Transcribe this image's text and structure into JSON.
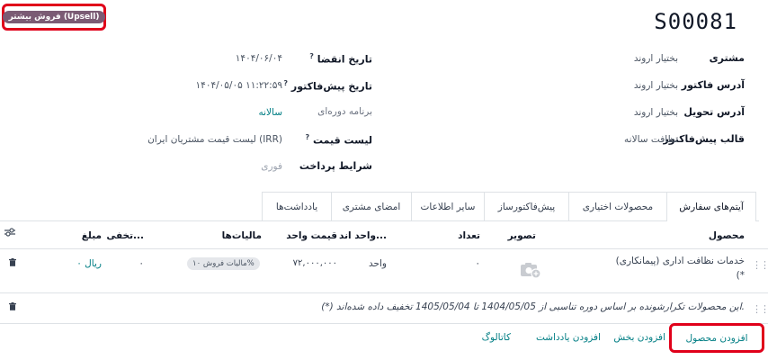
{
  "header": {
    "order_number": "S00081",
    "upsell_badge": "فروش بیشتر (Upsell)"
  },
  "left_fields": [
    {
      "label": "مشتری",
      "value": "بختیار اروند"
    },
    {
      "label": "آدرس فاکتور",
      "value": "بختیار اروند"
    },
    {
      "label": "آدرس تحویل",
      "value": "بختیار اروند"
    },
    {
      "label": "قالب پیش‌فاکتور",
      "value": "نظافت سالانه"
    }
  ],
  "right_fields": [
    {
      "label": "تاریخ انقضا",
      "help": "?",
      "value": "۱۴۰۴/۰۶/۰۴"
    },
    {
      "label": "تاریخ پیش‌فاکتور",
      "help": "?",
      "value": "۱۴۰۴/۰۵/۰۵ ۱۱:۲۲:۵۹"
    },
    {
      "label": "برنامه دوره‌ای",
      "value": "سالانه"
    },
    {
      "label": "لیست قیمت",
      "help": "?",
      "value": "لیست قیمت مشتریان ایران (IRR)"
    },
    {
      "label": "شرایط پرداخت",
      "value": "فوری"
    }
  ],
  "tabs": [
    {
      "label": "آیتم‌های سفارش",
      "active": true
    },
    {
      "label": "محصولات اختیاری"
    },
    {
      "label": "پیش‌فاکتورساز"
    },
    {
      "label": "سایر اطلاعات"
    },
    {
      "label": "امضای مشتری"
    },
    {
      "label": "یادداشت‌ها"
    }
  ],
  "table": {
    "headers": {
      "product": "محصول",
      "image": "تصویر",
      "quantity": "تعداد",
      "uom": "واحد اند...",
      "unit_price": "قیمت واحد",
      "taxes": "مالیات‌ها",
      "discount": "تخفی...",
      "amount": "مبلغ"
    },
    "rows": [
      {
        "product": "خدمات نظافت اداری (پیمانکاری)",
        "product_note": "(*",
        "quantity": "۰",
        "uom": "واحد",
        "unit_price": "۷۲,۰۰۰,۰۰۰",
        "tax": "مالیات فروش ۱۰%",
        "discount": "۰",
        "amount": "۰ ریال"
      }
    ],
    "note": "(*) این محصولات تکرارشونده بر اساس دوره تناسبی از 1404/05/05 تا 1405/05/04 تخفیف داده شده‌اند."
  },
  "actions": {
    "add_product": "افزودن محصول",
    "add_section": "افزودن بخش",
    "add_note": "افزودن یادداشت",
    "catalog": "کاتالوگ"
  },
  "colors": {
    "accent": "#017e84",
    "badge": "#7b5b74",
    "highlight": "#e0001a"
  }
}
